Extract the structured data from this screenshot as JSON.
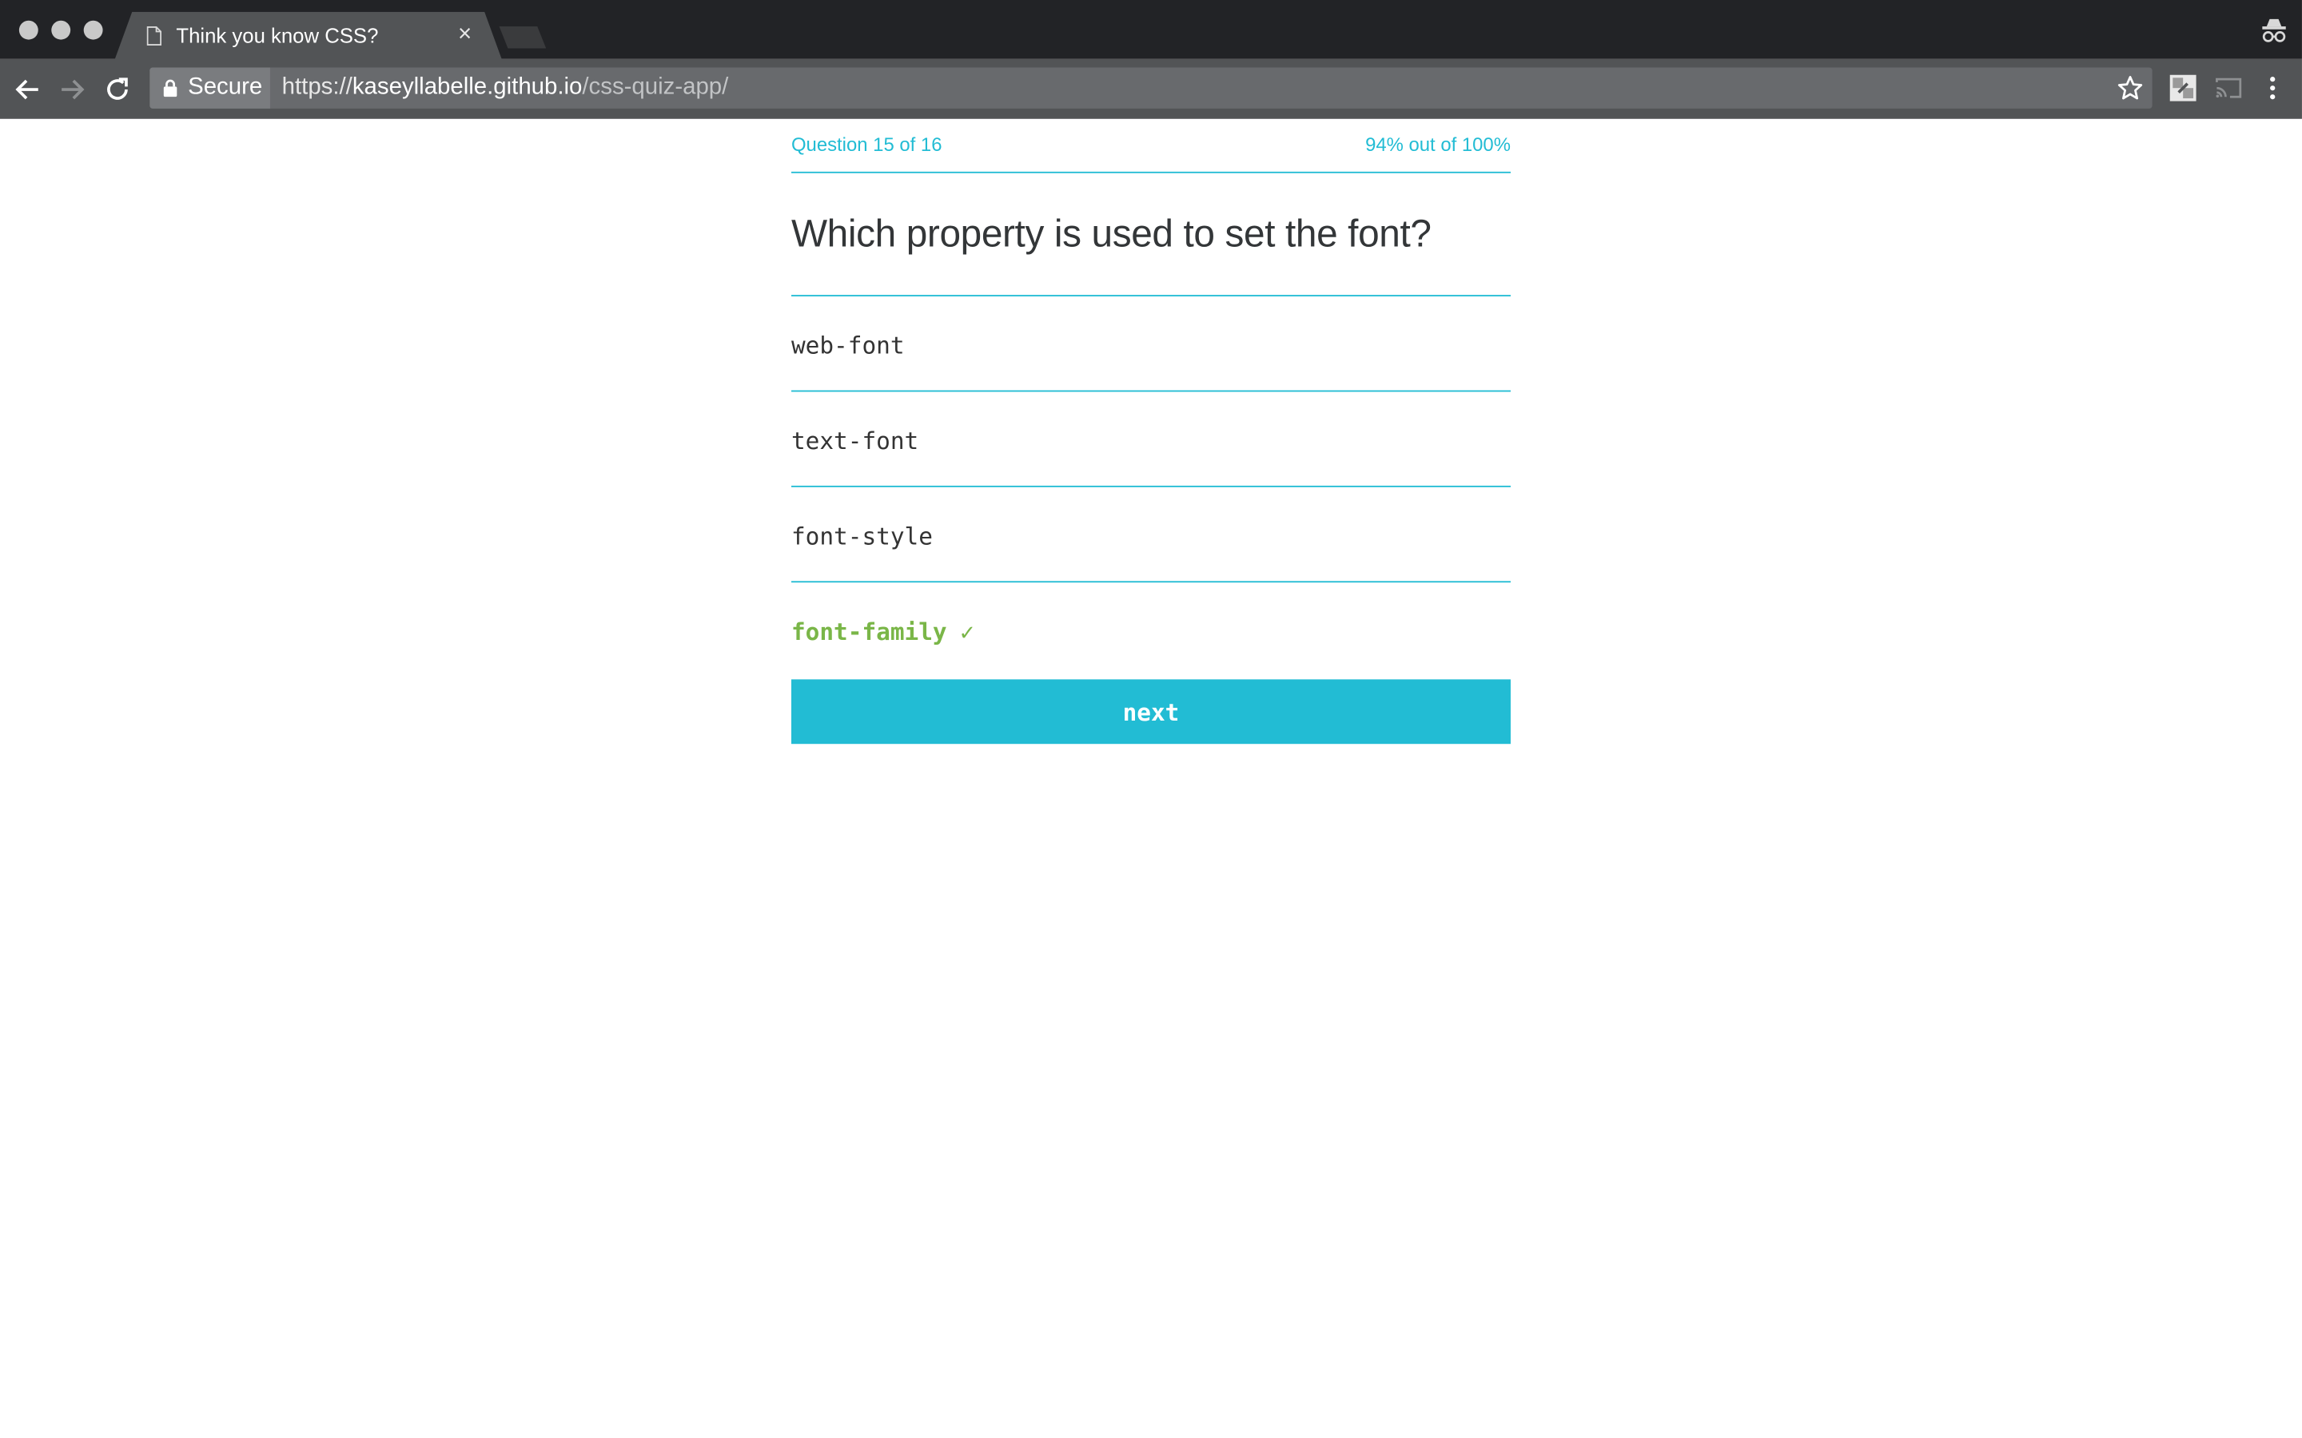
{
  "browser": {
    "tab_title": "Think you know CSS?",
    "tab_close": "×",
    "secure_label": "Secure",
    "url_scheme": "https://",
    "url_host": "kaseyllabelle.github.io",
    "url_path": "/css-quiz-app/",
    "icons": [
      "back-arrow-icon",
      "forward-arrow-icon",
      "reload-icon",
      "lock-icon",
      "star-icon",
      "extension-icon",
      "cast-icon",
      "menu-icon",
      "incognito-icon"
    ]
  },
  "quiz": {
    "progress": "Question 15 of 16",
    "score": "94% out of 100%",
    "question": "Which property is used to set the font?",
    "answers": [
      {
        "text": "web-font"
      },
      {
        "text": "text-font"
      },
      {
        "text": "font-style"
      },
      {
        "text": "font-family",
        "mark": "✓"
      }
    ],
    "next_label": "next"
  },
  "colors": {
    "accent": "#22bcd4",
    "correct": "#7ab648",
    "chrome_dark": "#222326",
    "chrome_toolbar": "#525456"
  }
}
